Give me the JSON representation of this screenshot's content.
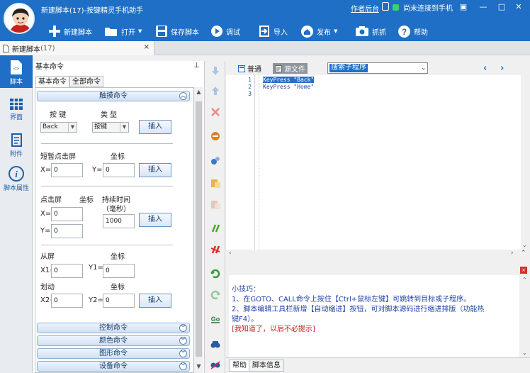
{
  "app": {
    "title": "新建脚本(17)-按键精灵手机助手",
    "author_link": "作者后台",
    "connection_status": "尚未连接到手机"
  },
  "toolbar": {
    "new_script": "新建脚本",
    "open": "打开",
    "save_script": "保存脚本",
    "debug": "调试",
    "import": "导入",
    "publish": "发布",
    "capture": "抓抓",
    "help": "帮助"
  },
  "doc_tab": {
    "label": "新建脚本",
    "count": "(17)"
  },
  "leftnav": {
    "script": "脚本",
    "ui": "界面",
    "attachment": "附件",
    "properties": "脚本属性"
  },
  "panel": {
    "title": "基本命令",
    "tabs": [
      "基本命令",
      "全部命令"
    ],
    "touch_section": "触摸命令",
    "key_label": "按 键",
    "type_label": "类 型",
    "key_value": "Back",
    "type_value": "按键",
    "insert": "插入",
    "tap_label": "短暂点击屏",
    "coord_label": "坐标",
    "x_label": "X=",
    "y_label": "Y=",
    "x_value": "0",
    "y_value": "0",
    "press_label": "点击屏",
    "duration_label": "持续时间",
    "duration_unit": "（毫秒）",
    "duration_value": "1000",
    "swipe_from": "从屏",
    "swipe_move": "划动",
    "x1_label": "X1=",
    "y1_label": "Y1=",
    "x2_label": "X2=",
    "y2_label": "Y2=",
    "control_section": "控制命令",
    "color_section": "颜色命令",
    "graphic_section": "图形命令",
    "device_section": "设备命令"
  },
  "editor": {
    "mode_normal": "普通",
    "mode_source": "源文件",
    "search_value": "搜索子程序",
    "lines": [
      {
        "num": "1",
        "cmd": "KeyPress",
        "arg": "\"Back\""
      },
      {
        "num": "2",
        "cmd": "KeyPress",
        "arg": "\"Home\""
      },
      {
        "num": "3",
        "cmd": "",
        "arg": ""
      }
    ]
  },
  "help": {
    "tip_title": "小技巧：",
    "tip1": "1、在GOTO、CALL命令上按住【Ctrl+鼠标左键】可跳转到目标或子程序。",
    "tip2": "2、脚本编辑工具栏新增【自动缩进】按钮，可对脚本源码进行缩进排版（功能热",
    "tip2b": "键F4）。",
    "dismiss": "[我知道了，以后不必提示]",
    "tab_help": "帮助",
    "tab_info": "脚本信息"
  }
}
